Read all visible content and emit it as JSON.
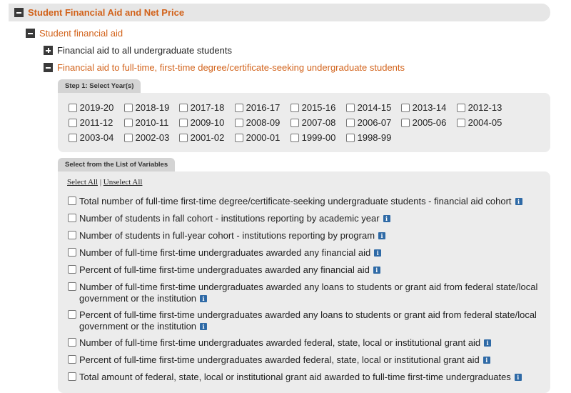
{
  "section": {
    "title": "Student Financial Aid and Net Price"
  },
  "subsection": {
    "title": "Student financial aid"
  },
  "rows": {
    "all_undergrad": "Financial aid to all undergraduate students",
    "ftft": "Financial aid to full-time, first-time degree/certificate-seeking undergraduate students"
  },
  "years_panel": {
    "tab_label": "Step 1: Select Year(s)",
    "years": [
      "2019-20",
      "2018-19",
      "2017-18",
      "2016-17",
      "2015-16",
      "2014-15",
      "2013-14",
      "2012-13",
      "2011-12",
      "2010-11",
      "2009-10",
      "2008-09",
      "2007-08",
      "2006-07",
      "2005-06",
      "2004-05",
      "2003-04",
      "2002-03",
      "2001-02",
      "2000-01",
      "1999-00",
      "1998-99"
    ]
  },
  "vars_panel": {
    "tab_label": "Select from the List of Variables",
    "select_all": "Select All",
    "separator": "|",
    "unselect_all": "Unselect All",
    "info_glyph": "i",
    "variables": [
      "Total number of full-time first-time degree/certificate-seeking undergraduate students - financial aid cohort",
      "Number of students in fall cohort - institutions reporting by academic year",
      "Number of students in full-year cohort - institutions reporting by program",
      "Number of full-time first-time undergraduates awarded any financial aid",
      "Percent of full-time first-time undergraduates awarded any financial aid",
      "Number of full-time first-time undergraduates awarded any loans to students or grant aid from federal state/local government or the institution",
      "Percent of full-time first-time undergraduates awarded any loans to students or grant aid from federal state/local government or the institution",
      "Number of full-time first-time undergraduates awarded federal, state, local or institutional grant aid",
      "Percent of full-time first-time undergraduates awarded federal, state, local or institutional grant aid",
      "Total amount of federal, state, local or institutional grant aid awarded to full-time first-time undergraduates"
    ]
  },
  "colors": {
    "accent": "#d2621a",
    "panel": "#ececec",
    "tab": "#d4d4d4",
    "info": "#2f6aa6"
  }
}
